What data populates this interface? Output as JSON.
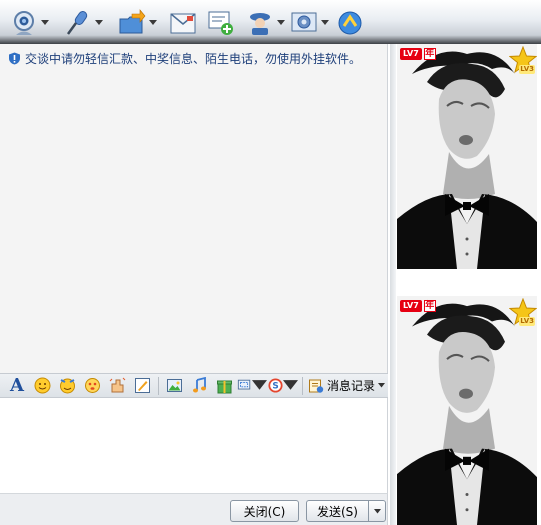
{
  "toolbar": {
    "items": [
      {
        "name": "webcam-icon",
        "has_dropdown": true
      },
      {
        "name": "microphone-icon",
        "has_dropdown": true
      },
      {
        "name": "transfer-folder-icon",
        "has_dropdown": true
      },
      {
        "name": "email-icon",
        "has_dropdown": false
      },
      {
        "name": "create-group-icon",
        "has_dropdown": false
      },
      {
        "name": "contact-card-icon",
        "has_dropdown": true
      },
      {
        "name": "app-settings-icon",
        "has_dropdown": true
      },
      {
        "name": "remote-assist-icon",
        "has_dropdown": false
      }
    ]
  },
  "notice": {
    "text": "交谈中请勿轻信汇款、中奖信息、陌生电话，勿使用外挂软件。",
    "icon": "shield-icon"
  },
  "contacts": [
    {
      "level_badge": "LV7",
      "year_badge": "年",
      "star_level": "LV3"
    },
    {
      "level_badge": "LV7",
      "year_badge": "年",
      "star_level": "LV3"
    }
  ],
  "format_toolbar": {
    "font_label": "A",
    "history_label": "消息记录",
    "icons": [
      "font-icon",
      "smiley-icon",
      "wink-icon",
      "magic-face-icon",
      "shake-hand-icon",
      "scribble-icon",
      "image-icon",
      "music-icon",
      "gift-icon",
      "screen-capture-icon",
      "sogou-icon",
      "history-icon"
    ]
  },
  "input": {
    "value": ""
  },
  "buttons": {
    "close_label": "关闭(C)",
    "send_label": "发送(S)"
  },
  "colors": {
    "notice_text": "#1e3f7a",
    "badge_red": "#e60012"
  }
}
